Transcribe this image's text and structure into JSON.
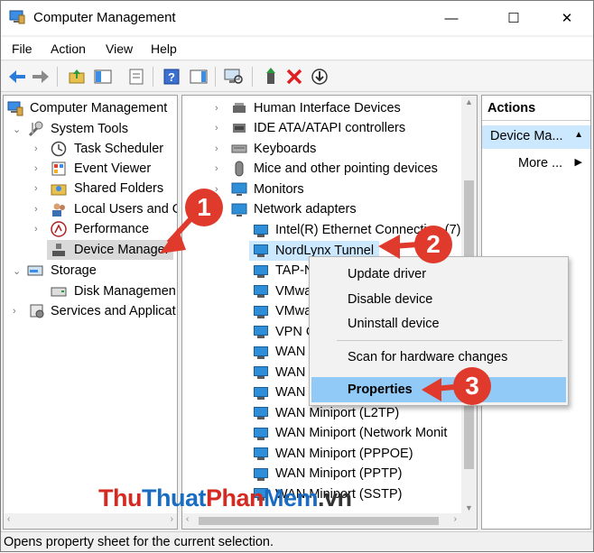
{
  "window": {
    "title": "Computer Management",
    "minimize": "—",
    "maximize": "☐",
    "close": "✕"
  },
  "menu": [
    "File",
    "Action",
    "View",
    "Help"
  ],
  "left_tree": {
    "root": "Computer Management",
    "system_tools": "System Tools",
    "task_scheduler": "Task Scheduler",
    "event_viewer": "Event Viewer",
    "shared_folders": "Shared Folders",
    "local_users": "Local Users and G",
    "performance": "Performance",
    "device_manager": "Device Manager",
    "storage": "Storage",
    "disk_management": "Disk Managemen",
    "services": "Services and Applicat"
  },
  "devices": {
    "hid": "Human Interface Devices",
    "ide": "IDE ATA/ATAPI controllers",
    "keyboards": "Keyboards",
    "mice": "Mice and other pointing devices",
    "monitors": "Monitors",
    "network_adapters": "Network adapters",
    "adapters": [
      "Intel(R) Ethernet Connection (7)",
      "NordLynx Tunnel",
      "TAP-N",
      "VMwa",
      "VMwa",
      "VPN C",
      "WAN",
      "WAN",
      "WAN",
      "WAN Miniport (L2TP)",
      "WAN Miniport (Network Monit",
      "WAN Miniport (PPPOE)",
      "WAN Miniport (PPTP)",
      "WAN Miniport (SSTP)"
    ]
  },
  "context_menu": {
    "update": "Update driver",
    "disable": "Disable device",
    "uninstall": "Uninstall device",
    "scan": "Scan for hardware changes",
    "properties": "Properties"
  },
  "actions": {
    "header": "Actions",
    "selected": "Device Ma...",
    "more": "More ..."
  },
  "status_text": "Opens property sheet for the current selection.",
  "annotations": [
    "1",
    "2",
    "3"
  ],
  "watermark": {
    "part1": "Thu",
    "part2": "Thuat",
    "part3": "Phan",
    "part4": "Mem",
    "part5": ".vn"
  },
  "colors": {
    "selection": "#cce8ff",
    "ctx_highlight": "#91c9f7",
    "badge_red": "#e03a2c",
    "watermark_red": "#d42a22",
    "watermark_blue": "#1a6cc0"
  }
}
